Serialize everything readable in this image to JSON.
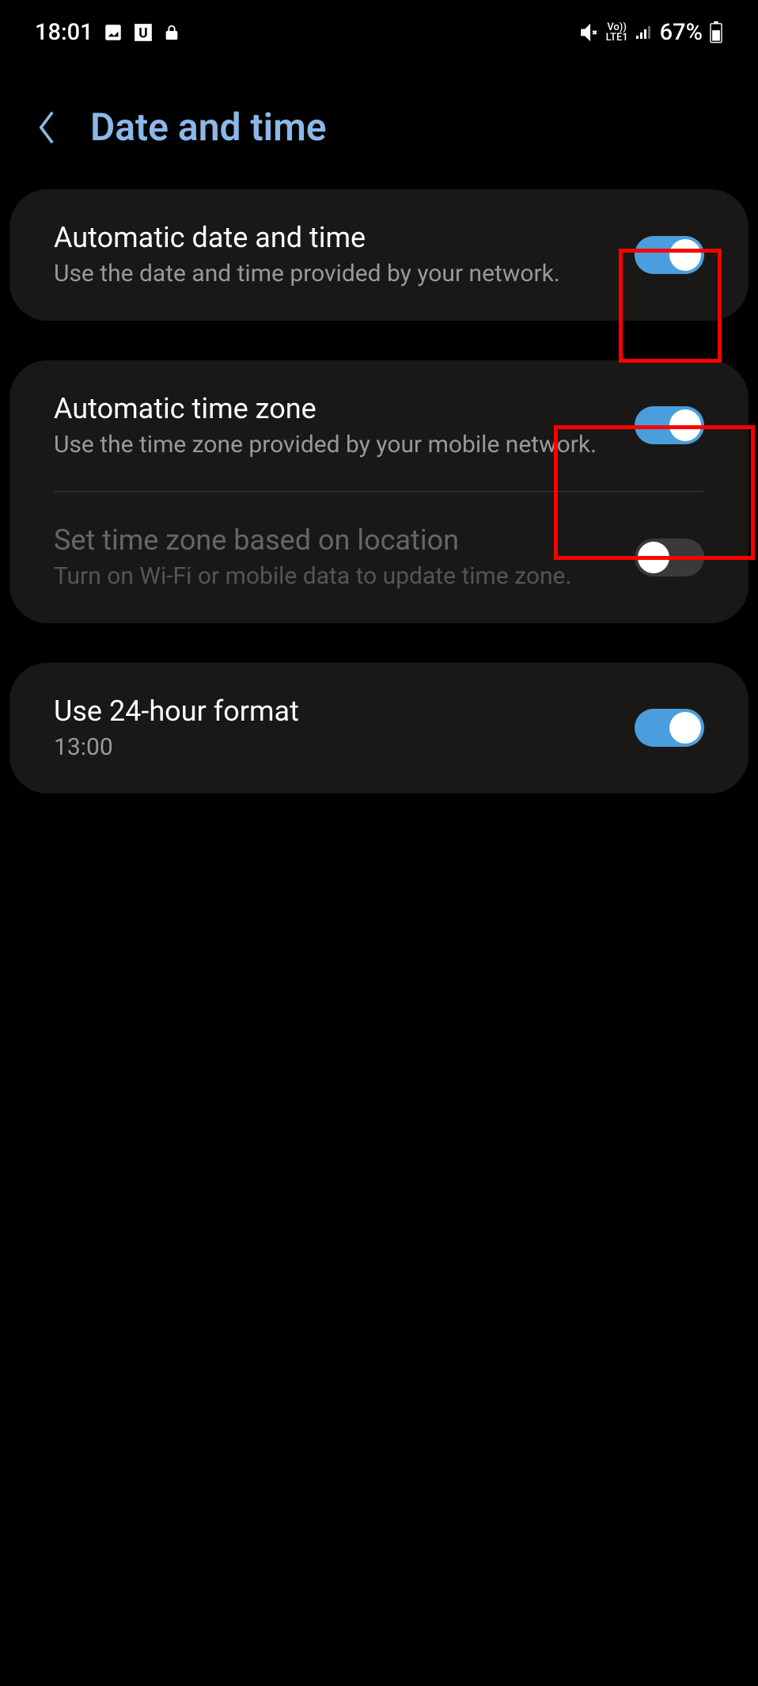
{
  "statusBar": {
    "time": "18:01",
    "batteryPercent": "67%"
  },
  "header": {
    "title": "Date and time"
  },
  "settings": {
    "auto_datetime": {
      "title": "Automatic date and time",
      "subtitle": "Use the date and time provided by your network."
    },
    "auto_timezone": {
      "title": "Automatic time zone",
      "subtitle": "Use the time zone provided by your mobile network."
    },
    "location_timezone": {
      "title": "Set time zone based on location",
      "subtitle": "Turn on Wi-Fi or mobile data to update time zone."
    },
    "hour_format": {
      "title": "Use 24-hour format",
      "subtitle": "13:00"
    }
  }
}
